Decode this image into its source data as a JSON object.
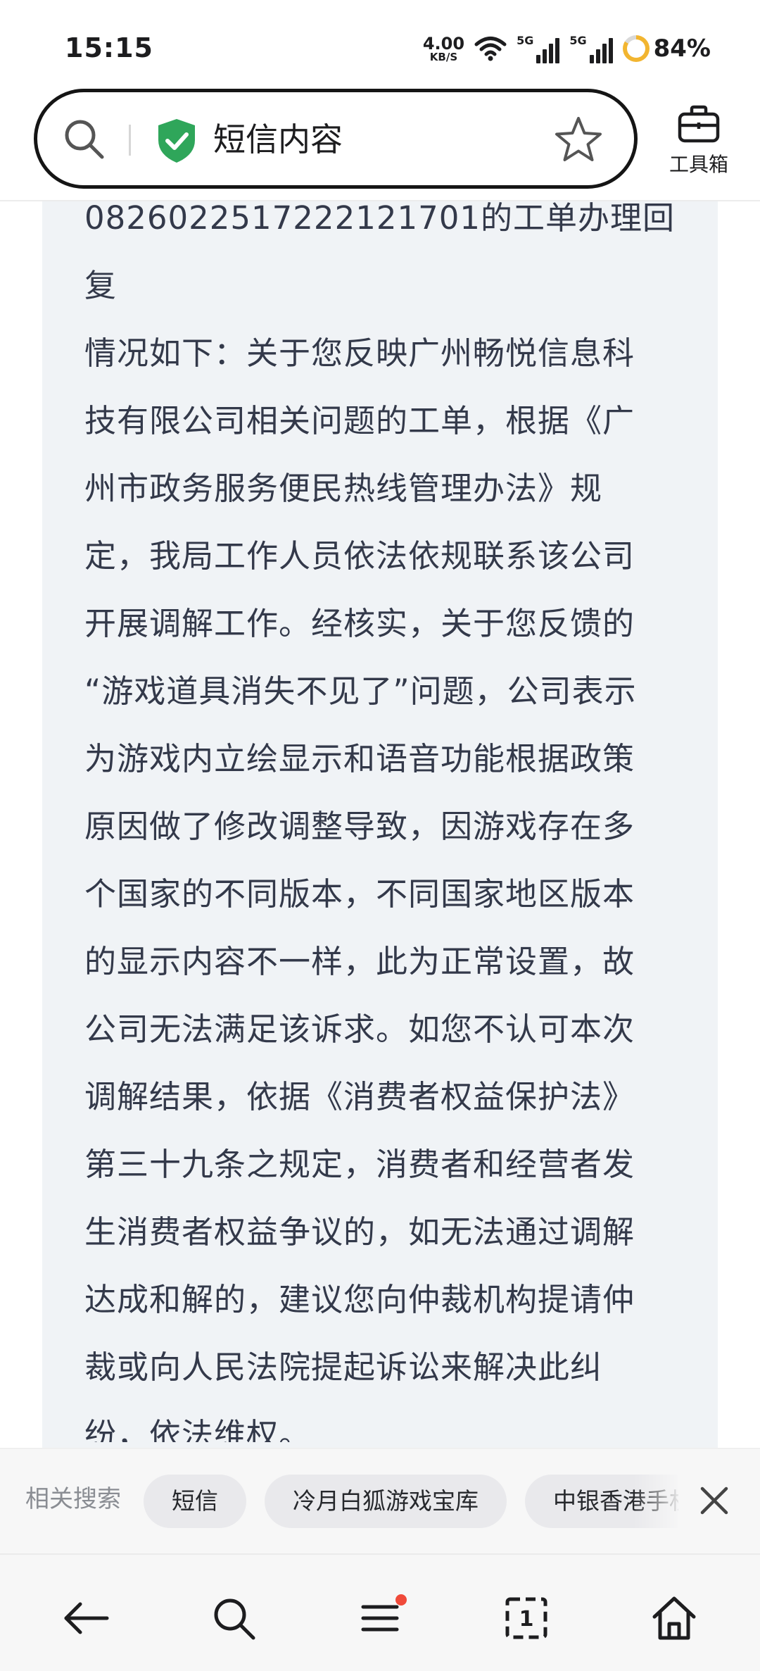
{
  "status_bar": {
    "time": "15:15",
    "net_speed_value": "4.00",
    "net_speed_unit": "KB/S",
    "sim1_label": "5G",
    "sim2_label": "5G",
    "battery_text": "84%",
    "battery_level_percent": 84
  },
  "header": {
    "search_query": "短信内容",
    "toolbox_label": "工具箱"
  },
  "message": {
    "lines": [
      "0826022517222121701的工单办理回复",
      "情况如下：关于您反映广州畅悦信息科",
      "技有限公司相关问题的工单，根据《广",
      "州市政务服务便民热线管理办法》规",
      "定，我局工作人员依法依规联系该公司",
      "开展调解工作。经核实，关于您反馈的",
      "“游戏道具消失不见了”问题，公司表示",
      "为游戏内立绘显示和语音功能根据政策",
      "原因做了修改调整导致，因游戏存在多",
      "个国家的不同版本，不同国家地区版本",
      "的显示内容不一样，此为正常设置，故",
      "公司无法满足该诉求。如您不认可本次",
      "调解结果，依据《消费者权益保护法》",
      "第三十九条之规定，消费者和经营者发",
      "生消费者权益争议的，如无法通过调解",
      "达成和解的，建议您向仲裁机构提请仲",
      "裁或向人民法院提起诉讼来解决此纠",
      "纷，依法维权。"
    ]
  },
  "related": {
    "label": "相关搜索",
    "chips": [
      "短信",
      "冷月白狐游戏宝库",
      "中银香港手机银行"
    ]
  },
  "bottom_nav": {
    "tab_count": "1"
  },
  "colors": {
    "card_background": "#f0f3f6",
    "body_text": "#33394a",
    "shield_green": "#2fa65a",
    "notification_dot": "#f04a3a",
    "battery_ring": "#f2b530"
  }
}
